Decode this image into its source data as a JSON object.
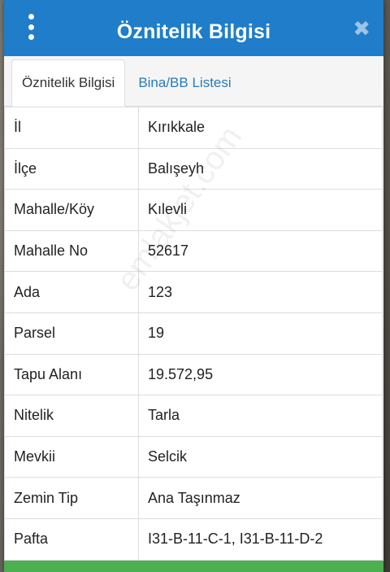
{
  "header": {
    "title": "Öznitelik Bilgisi",
    "close_glyph": "✖"
  },
  "tabs": [
    {
      "label": "Öznitelik Bilgisi",
      "active": true
    },
    {
      "label": "Bina/BB Listesi",
      "active": false
    }
  ],
  "rows": [
    {
      "key": "İl",
      "value": "Kırıkkale"
    },
    {
      "key": "İlçe",
      "value": "Balışeyh"
    },
    {
      "key": "Mahalle/Köy",
      "value": "Kılevli"
    },
    {
      "key": "Mahalle No",
      "value": "52617"
    },
    {
      "key": "Ada",
      "value": "123"
    },
    {
      "key": "Parsel",
      "value": "19"
    },
    {
      "key": "Tapu Alanı",
      "value": "19.572,95"
    },
    {
      "key": "Nitelik",
      "value": "Tarla"
    },
    {
      "key": "Mevkii",
      "value": "Selcik"
    },
    {
      "key": "Zemin Tip",
      "value": "Ana Taşınmaz"
    },
    {
      "key": "Pafta",
      "value": "I31-B-11-C-1, I31-B-11-D-2"
    }
  ],
  "watermark": "emlakjet.com",
  "colors": {
    "header": "#1f7dc9",
    "tab_link": "#2a7ab8",
    "bottom_bar": "#4caf50"
  }
}
